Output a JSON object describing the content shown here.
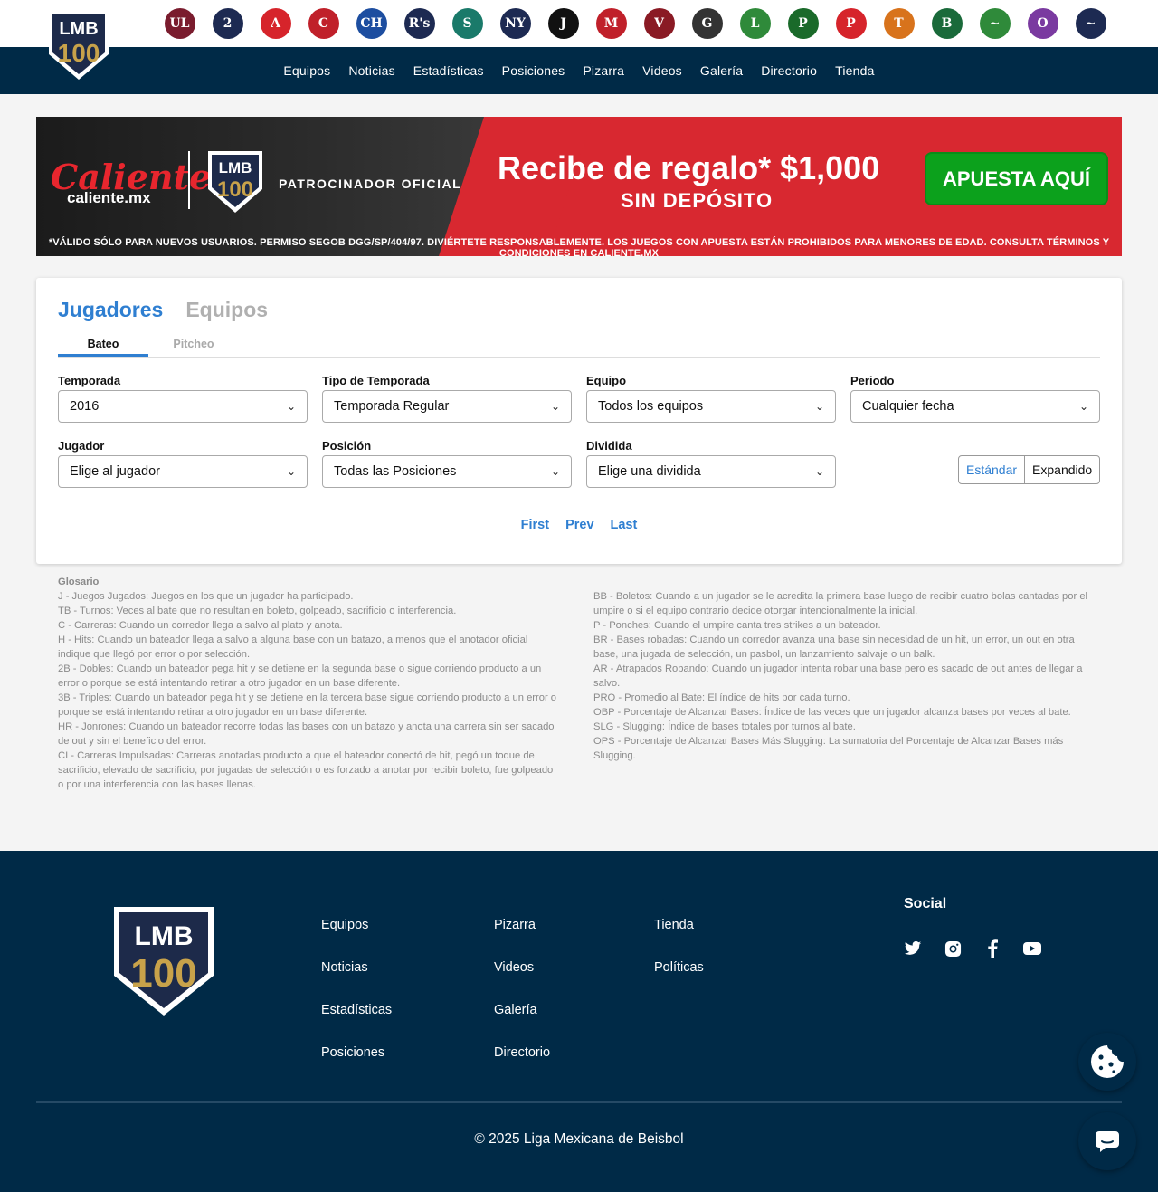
{
  "teams": [
    {
      "icon": "team-logo-1",
      "mark": "UL",
      "color": "#7a1c2e"
    },
    {
      "icon": "team-logo-2",
      "mark": "2",
      "color": "#1d2a52"
    },
    {
      "icon": "team-logo-3",
      "mark": "A",
      "color": "#d6242b"
    },
    {
      "icon": "team-logo-4",
      "mark": "C",
      "color": "#c0202a"
    },
    {
      "icon": "team-logo-5",
      "mark": "CH",
      "color": "#1d4ea0"
    },
    {
      "icon": "team-logo-6",
      "mark": "R's",
      "color": "#1d2a52"
    },
    {
      "icon": "team-logo-7",
      "mark": "S",
      "color": "#1a7a6a"
    },
    {
      "icon": "team-logo-8",
      "mark": "NY",
      "color": "#1d2a52"
    },
    {
      "icon": "team-logo-9",
      "mark": "J",
      "color": "#111111"
    },
    {
      "icon": "team-logo-10",
      "mark": "M",
      "color": "#c0202a"
    },
    {
      "icon": "team-logo-11",
      "mark": "V",
      "color": "#8a1a24"
    },
    {
      "icon": "team-logo-12",
      "mark": "G",
      "color": "#333333"
    },
    {
      "icon": "team-logo-13",
      "mark": "L",
      "color": "#2f8a3a"
    },
    {
      "icon": "team-logo-14",
      "mark": "P",
      "color": "#1a6a2a"
    },
    {
      "icon": "team-logo-15",
      "mark": "P",
      "color": "#d6242b"
    },
    {
      "icon": "team-logo-16",
      "mark": "T",
      "color": "#d8731c"
    },
    {
      "icon": "team-logo-17",
      "mark": "B",
      "color": "#1a6a3a"
    },
    {
      "icon": "team-logo-18",
      "mark": "~",
      "color": "#2f8a3a"
    },
    {
      "icon": "team-logo-19",
      "mark": "O",
      "color": "#7a3aa0"
    },
    {
      "icon": "team-logo-20",
      "mark": "~",
      "color": "#1d2a52"
    }
  ],
  "nav": {
    "items": [
      "Equipos",
      "Noticias",
      "Estadísticas",
      "Posiciones",
      "Pizarra",
      "Videos",
      "Galería",
      "Directorio",
      "Tienda"
    ]
  },
  "banner": {
    "brand": "Caliente",
    "site": "caliente.mx",
    "sponsor": "PATROCINADOR OFICIAL",
    "gift": "Recibe de regalo* $1,000",
    "nodeposit": "SIN DEPÓSITO",
    "cta": "APUESTA AQUÍ",
    "legal": "*VÁLIDO SÓLO PARA NUEVOS USUARIOS. PERMISO SEGOB DGG/SP/404/97. DIVIÉRTETE RESPONSABLEMENTE. LOS JUEGOS CON APUESTA ESTÁN PROHIBIDOS PARA MENORES DE EDAD. CONSULTA TÉRMINOS Y CONDICIONES EN CALIENTE.MX"
  },
  "stats": {
    "tabs": [
      "Jugadores",
      "Equipos"
    ],
    "subtabs": [
      "Bateo",
      "Pitcheo"
    ],
    "filters": {
      "season": {
        "label": "Temporada",
        "value": "2016"
      },
      "season_type": {
        "label": "Tipo de Temporada",
        "value": "Temporada Regular"
      },
      "team": {
        "label": "Equipo",
        "value": "Todos los equipos"
      },
      "period": {
        "label": "Periodo",
        "value": "Cualquier fecha"
      },
      "player": {
        "label": "Jugador",
        "value": "Elige al jugador"
      },
      "position": {
        "label": "Posición",
        "value": "Todas las Posiciones"
      },
      "division": {
        "label": "Dividida",
        "value": "Elige una dividida"
      }
    },
    "view_toggle": {
      "standard": "Estándar",
      "expanded": "Expandido"
    },
    "pager": {
      "first": "First",
      "prev": "Prev",
      "last": "Last"
    }
  },
  "glossary": {
    "title": "Glosario",
    "left": [
      "J - Juegos Jugados: Juegos en los que un jugador ha participado.",
      "TB - Turnos: Veces al bate que no resultan en boleto, golpeado, sacrificio o interferencia.",
      "C - Carreras: Cuando un corredor llega a salvo al plato y anota.",
      "H - Hits: Cuando un bateador llega a salvo a alguna base con un batazo, a menos que el anotador oficial indique que llegó por error o por selección.",
      "2B - Dobles: Cuando un bateador pega hit y se detiene en la segunda base o sigue corriendo producto a un error o porque se está intentando retirar a otro jugador en un base diferente.",
      "3B - Triples: Cuando un bateador pega hit y se detiene en la tercera base sigue corriendo producto a un error o porque se está intentando retirar a otro jugador en un base diferente.",
      "HR - Jonrones: Cuando un bateador recorre todas las bases con un batazo y anota una carrera sin ser sacado de out y sin el beneficio del error.",
      "CI - Carreras Impulsadas: Carreras anotadas producto a que el bateador conectó de hit, pegó un toque de sacrificio, elevado de sacrificio, por jugadas de selección o es forzado a anotar por recibir boleto, fue golpeado o por una interferencia con las bases llenas."
    ],
    "right": [
      "BB - Boletos: Cuando a un jugador se le acredita la primera base luego de recibir cuatro bolas cantadas por el umpire o si el equipo contrario decide otorgar intencionalmente la inicial.",
      "P - Ponches: Cuando el umpire canta tres strikes a un bateador.",
      "BR - Bases robadas: Cuando un corredor avanza una base sin necesidad de un hit, un error, un out en otra base, una jugada de selección, un pasbol, un lanzamiento salvaje o un balk.",
      "AR - Atrapados Robando: Cuando un jugador intenta robar una base pero es sacado de out antes de llegar a salvo.",
      "PRO - Promedio al Bate: El índice de hits por cada turno.",
      "OBP - Porcentaje de Alcanzar Bases: Índice de las veces que un jugador alcanza bases por veces al bate.",
      "SLG - Slugging: Índice de bases totales por turnos al bate.",
      "OPS - Porcentaje de Alcanzar Bases Más Slugging: La sumatoria del Porcentaje de Alcanzar Bases más Slugging."
    ]
  },
  "footer": {
    "col1": [
      "Equipos",
      "Noticias",
      "Estadísticas",
      "Posiciones"
    ],
    "col2": [
      "Pizarra",
      "Videos",
      "Galería",
      "Directorio"
    ],
    "col3": [
      "Tienda",
      "Políticas"
    ],
    "social_title": "Social",
    "social": [
      "twitter-icon",
      "instagram-icon",
      "facebook-icon",
      "youtube-icon"
    ],
    "copyright": "© 2025 Liga Mexicana de Beisbol"
  },
  "colors": {
    "navy": "#002a47",
    "accent": "#2f7fd1",
    "gold": "#c8a24a",
    "banner_red": "#d82830",
    "cta_green": "#0ca11c"
  }
}
